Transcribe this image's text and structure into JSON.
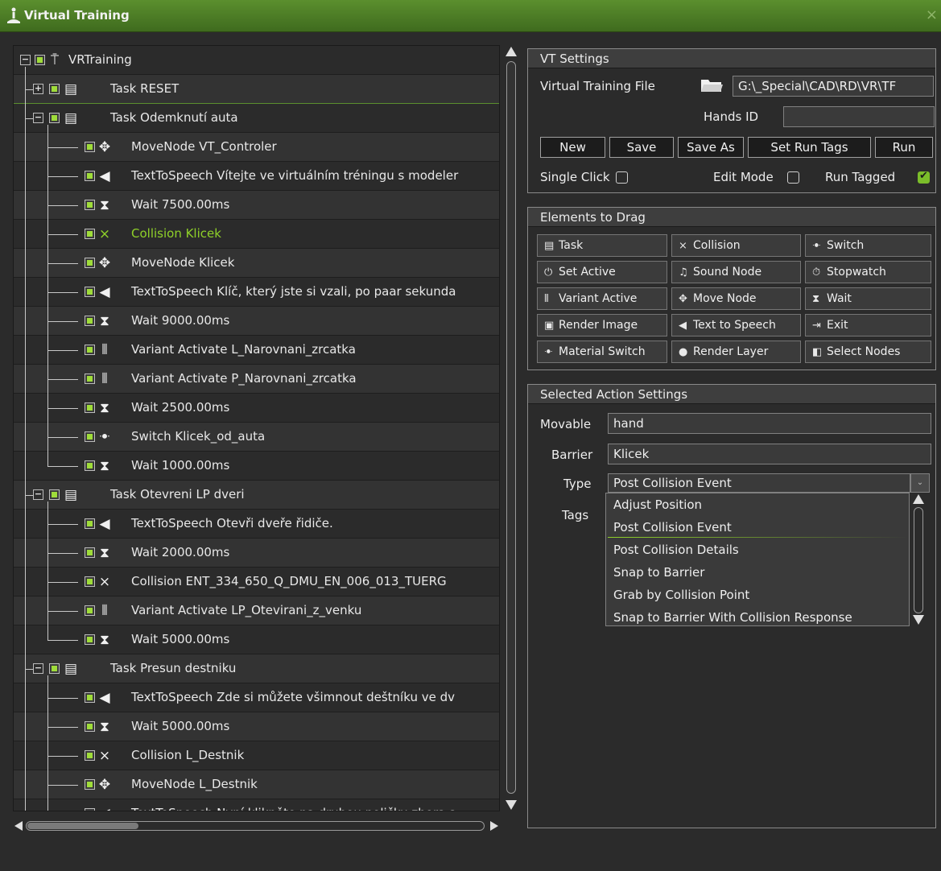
{
  "window": {
    "title": "Virtual Training",
    "close_glyph": "×"
  },
  "tree": {
    "rows": [
      {
        "label": "VRTraining",
        "level": 0,
        "expander": "−",
        "icon": "person-icon",
        "glyph": "⍑",
        "highlight": false
      },
      {
        "label": "Task RESET",
        "level": 1,
        "expander": "+",
        "icon": "task-icon",
        "glyph": "▤",
        "highlight": false
      },
      {
        "label": "Task Odemknutí auta",
        "level": 1,
        "expander": "−",
        "icon": "task-icon",
        "glyph": "▤",
        "highlight": false
      },
      {
        "label": "MoveNode VT_Controler",
        "level": 2,
        "icon": "move-icon",
        "glyph": "✥",
        "highlight": false
      },
      {
        "label": "TextToSpeech Vítejte ve virtuálním tréningu s modeler",
        "level": 2,
        "icon": "speech-icon",
        "glyph": "◀",
        "highlight": false
      },
      {
        "label": "Wait 7500.00ms",
        "level": 2,
        "icon": "hourglass-icon",
        "glyph": "⧗",
        "highlight": false
      },
      {
        "label": "Collision Klicek",
        "level": 2,
        "icon": "collision-icon",
        "glyph": "⨯",
        "highlight": true
      },
      {
        "label": "MoveNode Klicek",
        "level": 2,
        "icon": "move-icon",
        "glyph": "✥",
        "highlight": false
      },
      {
        "label": "TextToSpeech Klíč, který jste si vzali, po paar sekunda",
        "level": 2,
        "icon": "speech-icon",
        "glyph": "◀",
        "highlight": false
      },
      {
        "label": "Wait 9000.00ms",
        "level": 2,
        "icon": "hourglass-icon",
        "glyph": "⧗",
        "highlight": false
      },
      {
        "label": "Variant Activate L_Narovnani_zrcatka",
        "level": 2,
        "icon": "variant-icon",
        "glyph": "⦀",
        "highlight": false
      },
      {
        "label": "Variant Activate P_Narovnani_zrcatka",
        "level": 2,
        "icon": "variant-icon",
        "glyph": "⦀",
        "highlight": false
      },
      {
        "label": "Wait 2500.00ms",
        "level": 2,
        "icon": "hourglass-icon",
        "glyph": "⧗",
        "highlight": false
      },
      {
        "label": "Switch Klicek_od_auta",
        "level": 2,
        "icon": "switch-icon",
        "glyph": "ꔹ",
        "highlight": false
      },
      {
        "label": "Wait 1000.00ms",
        "level": 2,
        "icon": "hourglass-icon",
        "glyph": "⧗",
        "highlight": false
      },
      {
        "label": "Task Otevreni LP dveri",
        "level": 1,
        "expander": "−",
        "icon": "task-icon",
        "glyph": "▤",
        "highlight": false
      },
      {
        "label": "TextToSpeech Otevři dveře řidiče.",
        "level": 2,
        "icon": "speech-icon",
        "glyph": "◀",
        "highlight": false
      },
      {
        "label": "Wait 2000.00ms",
        "level": 2,
        "icon": "hourglass-icon",
        "glyph": "⧗",
        "highlight": false
      },
      {
        "label": "Collision ENT_334_650_Q_DMU_EN_006_013_TUERG",
        "level": 2,
        "icon": "collision-icon",
        "glyph": "⨯",
        "highlight": false
      },
      {
        "label": "Variant Activate LP_Otevirani_z_venku",
        "level": 2,
        "icon": "variant-icon",
        "glyph": "⦀",
        "highlight": false
      },
      {
        "label": "Wait 5000.00ms",
        "level": 2,
        "icon": "hourglass-icon",
        "glyph": "⧗",
        "highlight": false
      },
      {
        "label": "Task Presun destniku",
        "level": 1,
        "expander": "−",
        "icon": "task-icon",
        "glyph": "▤",
        "highlight": false
      },
      {
        "label": "TextToSpeech Zde si můžete všimnout deštníku ve dv",
        "level": 2,
        "icon": "speech-icon",
        "glyph": "◀",
        "highlight": false
      },
      {
        "label": "Wait 5000.00ms",
        "level": 2,
        "icon": "hourglass-icon",
        "glyph": "⧗",
        "highlight": false
      },
      {
        "label": "Collision L_Destnik",
        "level": 2,
        "icon": "collision-icon",
        "glyph": "⨯",
        "highlight": false
      },
      {
        "label": "MoveNode L_Destnik",
        "level": 2,
        "icon": "move-icon",
        "glyph": "✥",
        "highlight": false
      },
      {
        "label": "TextToSpeech Nyní klikněte na druhou poličku zhora a",
        "level": 2,
        "icon": "speech-icon",
        "glyph": "◀",
        "highlight": false
      }
    ]
  },
  "vt_settings": {
    "header": "VT Settings",
    "file_label": "Virtual Training File",
    "file_value": "G:\\_Special\\CAD\\RD\\VR\\TF",
    "hands_label": "Hands ID",
    "hands_value": "",
    "buttons": {
      "new": "New",
      "save": "Save",
      "save_as": "Save As",
      "set_run_tags": "Set Run Tags",
      "run": "Run"
    },
    "single_click": "Single Click",
    "edit_mode": "Edit Mode",
    "run_tagged": "Run Tagged"
  },
  "elements": {
    "header": "Elements to Drag",
    "items": [
      {
        "label": "Task",
        "glyph": "▤",
        "icon": "task-icon"
      },
      {
        "label": "Collision",
        "glyph": "⨯",
        "icon": "collision-icon"
      },
      {
        "label": "Switch",
        "glyph": "ꔹ",
        "icon": "switch-icon"
      },
      {
        "label": "Set Active",
        "glyph": "⏻",
        "icon": "power-icon"
      },
      {
        "label": "Sound Node",
        "glyph": "♫",
        "icon": "music-icon"
      },
      {
        "label": "Stopwatch",
        "glyph": "⏱",
        "icon": "stopwatch-icon"
      },
      {
        "label": "Variant Active",
        "glyph": "⦀",
        "icon": "variant-icon"
      },
      {
        "label": "Move Node",
        "glyph": "✥",
        "icon": "move-icon"
      },
      {
        "label": "Wait",
        "glyph": "⧗",
        "icon": "hourglass-icon"
      },
      {
        "label": "Render Image",
        "glyph": "▣",
        "icon": "image-icon"
      },
      {
        "label": "Text to Speech",
        "glyph": "◀",
        "icon": "speech-icon"
      },
      {
        "label": "Exit",
        "glyph": "⇥",
        "icon": "exit-icon"
      },
      {
        "label": "Material Switch",
        "glyph": "ꔹ",
        "icon": "material-switch-icon"
      },
      {
        "label": "Render Layer",
        "glyph": "●",
        "icon": "layer-icon"
      },
      {
        "label": "Select Nodes",
        "glyph": "◧",
        "icon": "select-nodes-icon"
      }
    ]
  },
  "action": {
    "header": "Selected Action Settings",
    "movable_label": "Movable",
    "movable_value": "hand",
    "barrier_label": "Barrier",
    "barrier_value": "Klicek",
    "type_label": "Type",
    "type_value": "Post Collision Event",
    "tags_label": "Tags",
    "type_options": [
      "Adjust Position",
      "Post Collision Event",
      "Post Collision Details",
      "Snap to Barrier",
      "Grab by Collision Point",
      "Snap to Barrier With Collision Response"
    ]
  },
  "colors": {
    "accent": "#8fd129",
    "titlebar": "#4f7f26",
    "panel": "#2b2b2b"
  }
}
